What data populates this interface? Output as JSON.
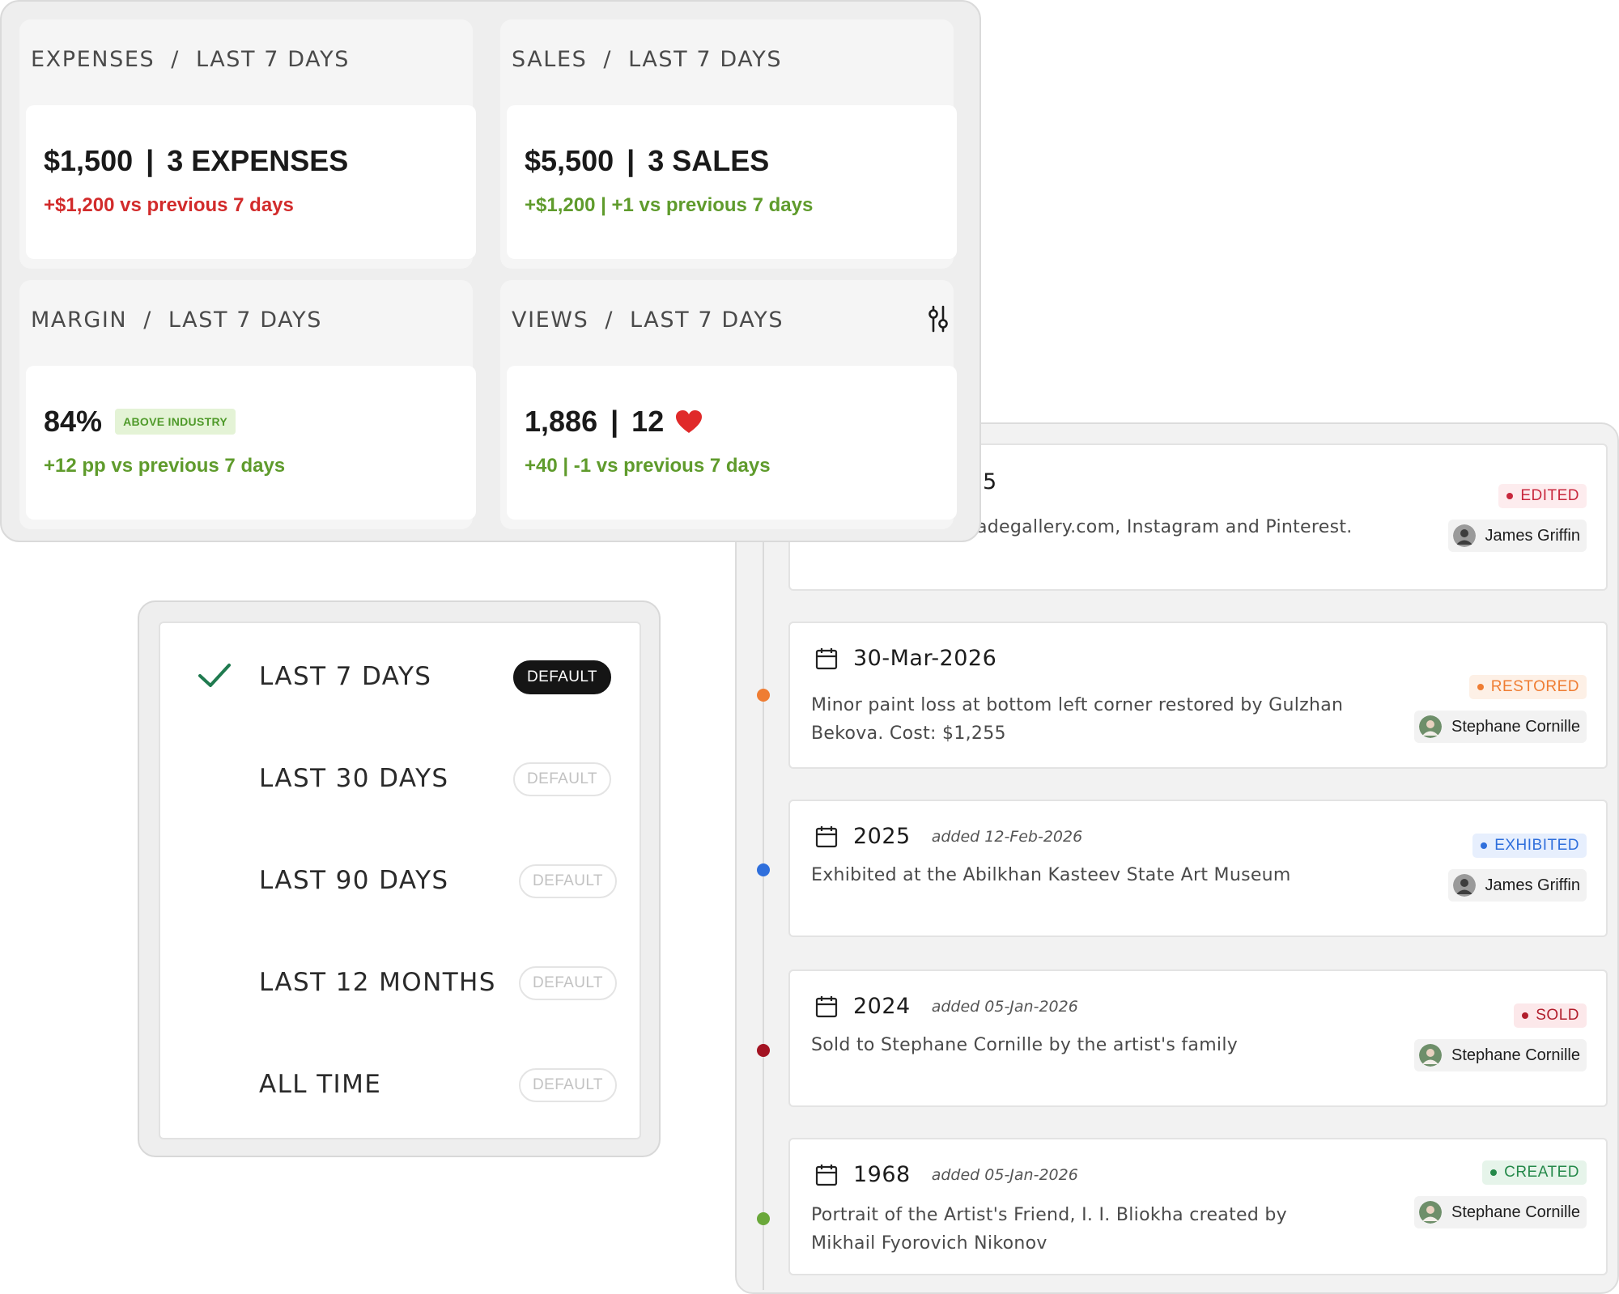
{
  "kpi": {
    "expenses": {
      "metric": "EXPENSES",
      "period": "LAST 7 DAYS",
      "value": "$1,500",
      "count": "3 EXPENSES",
      "change": "+$1,200 vs previous 7 days",
      "change_color": "#d22b2b"
    },
    "sales": {
      "metric": "SALES",
      "period": "LAST 7 DAYS",
      "value": "$5,500",
      "count": "3 SALES",
      "change": "+$1,200 | +1 vs previous 7 days",
      "change_color": "#5f9b2c"
    },
    "margin": {
      "metric": "MARGIN",
      "period": "LAST 7 DAYS",
      "value": "84%",
      "badge": "ABOVE INDUSTRY",
      "change": "+12 pp vs previous 7 days",
      "change_color": "#5f9b2c"
    },
    "views": {
      "metric": "VIEWS",
      "period": "LAST 7 DAYS",
      "value": "1,886",
      "likes": "12",
      "like_icon": "heart-icon",
      "filter_icon": "sliders-icon",
      "change": "+40 | -1 vs previous 7 days",
      "change_color": "#5f9b2c"
    }
  },
  "range_menu": {
    "items": [
      {
        "label": "LAST 7 DAYS",
        "default_label": "DEFAULT",
        "selected": true
      },
      {
        "label": "LAST 30 DAYS",
        "default_label": "DEFAULT",
        "selected": false
      },
      {
        "label": "LAST 90 DAYS",
        "default_label": "DEFAULT",
        "selected": false
      },
      {
        "label": "LAST 12 MONTHS",
        "default_label": "DEFAULT",
        "selected": false
      },
      {
        "label": "ALL TIME",
        "default_label": "DEFAULT",
        "selected": false
      }
    ],
    "check_icon": "checkmark-icon",
    "check_color": "#1f7a4f"
  },
  "timeline": {
    "entries": [
      {
        "date": "5",
        "added": "",
        "description": "adegallery.com, Instagram and Pinterest.",
        "status": "EDITED",
        "status_color": "#c8283d",
        "status_bg": "#fdecee",
        "user": "James Griffin",
        "dot_color": "#bdbdbd"
      },
      {
        "date": "30-Mar-2026",
        "added": "",
        "description": "Minor paint loss at bottom left corner restored by Gulzhan Bekova. Cost: $1,255",
        "status": "RESTORED",
        "status_color": "#ef7d33",
        "status_bg": "#fdf0e6",
        "user": "Stephane Cornille",
        "dot_color": "#ef7d33"
      },
      {
        "date": "2025",
        "added": "added 12-Feb-2026",
        "description": "Exhibited at the Abilkhan Kasteev State Art Museum",
        "status": "EXHIBITED",
        "status_color": "#2f6fdc",
        "status_bg": "#e7effd",
        "user": "James Griffin",
        "dot_color": "#2f6fdc"
      },
      {
        "date": "2024",
        "added": "added 05-Jan-2026",
        "description": "Sold to Stephane Cornille by the artist's family",
        "status": "SOLD",
        "status_color": "#b11e2c",
        "status_bg": "#fce8ea",
        "user": "Stephane Cornille",
        "dot_color": "#a31322"
      },
      {
        "date": "1968",
        "added": "added 05-Jan-2026",
        "description": "Portrait of the Artist's Friend, I. I. Bliokha created by Mikhail Fyorovich Nikonov",
        "status": "CREATED",
        "status_color": "#25894a",
        "status_bg": "#e6f4ea",
        "user": "Stephane Cornille",
        "dot_color": "#6aa83a"
      }
    ],
    "calendar_icon": "calendar-icon",
    "avatar_icon": "avatar"
  }
}
